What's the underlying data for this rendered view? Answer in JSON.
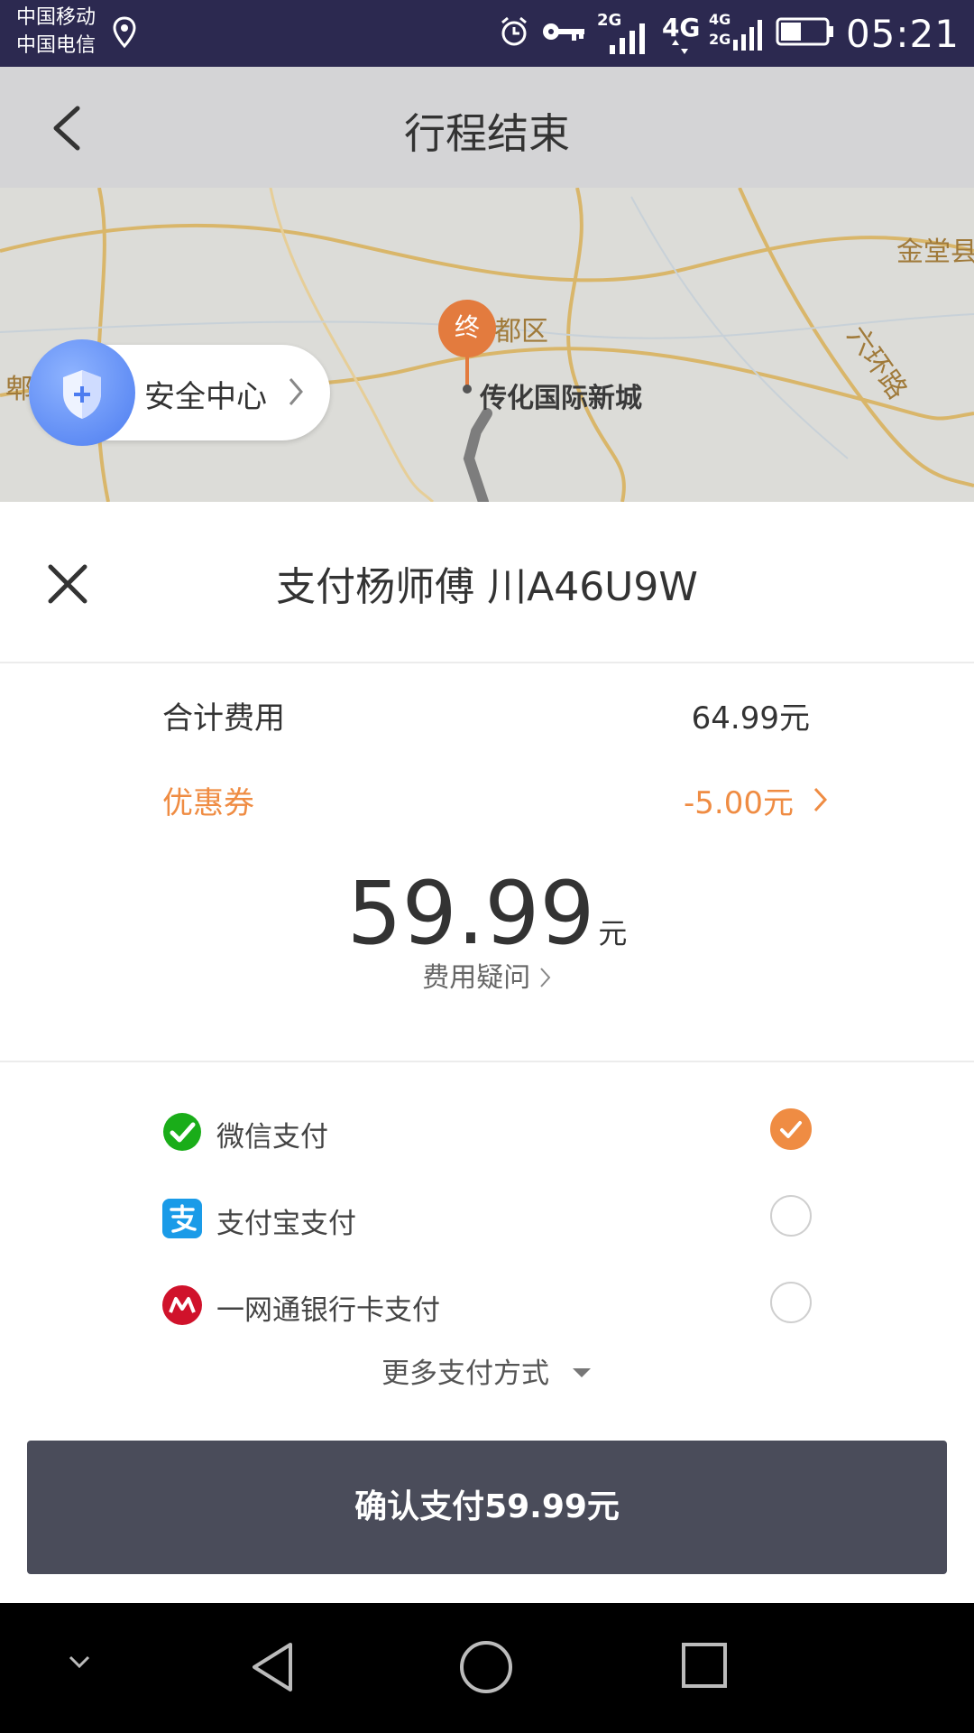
{
  "status_bar": {
    "carrier_1": "中国移动",
    "carrier_2": "中国电信",
    "signal_2g": "2G",
    "signal_4g": "4G",
    "signal_4g_small": "4G",
    "signal_2g_small": "2G",
    "time": "05:21"
  },
  "header": {
    "title": "行程结束"
  },
  "map": {
    "district_label": "都区",
    "poi_label": "传化国际新城",
    "town_label": "金堂县",
    "road_label": "六环路",
    "left_edge_label": "郫",
    "end_marker_label": "终",
    "safety_center_label": "安全中心"
  },
  "payment": {
    "title": "支付杨师傅 川A46U9W",
    "total_label": "合计费用",
    "total_value": "64.99元",
    "coupon_label": "优惠券",
    "coupon_value": "-5.00元",
    "amount": "59.99",
    "amount_unit": "元",
    "fee_question": "费用疑问",
    "methods": [
      {
        "label": "微信支付",
        "selected": true,
        "icon": "wechat-pay-icon",
        "color": "#1aad19"
      },
      {
        "label": "支付宝支付",
        "selected": false,
        "icon": "alipay-icon",
        "color": "#1a9be8"
      },
      {
        "label": "一网通银行卡支付",
        "selected": false,
        "icon": "cmb-card-icon",
        "color": "#d0122b"
      }
    ],
    "more_methods": "更多支付方式",
    "confirm_button": "确认支付59.99元"
  },
  "colors": {
    "accent": "#ef8c43",
    "status_bar": "#2c2950",
    "confirm_button": "#4a4c5a"
  }
}
